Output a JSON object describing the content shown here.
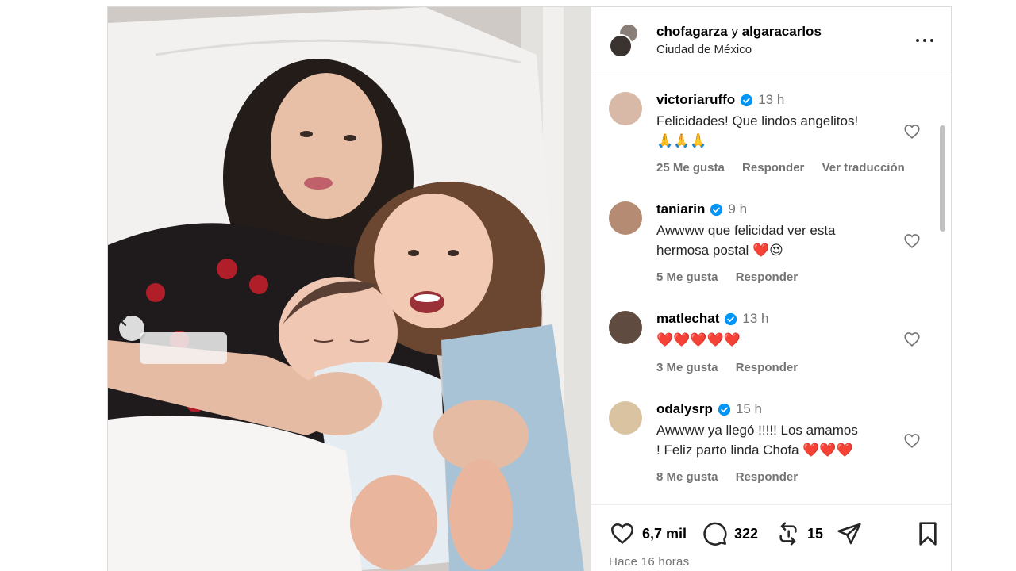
{
  "header": {
    "user1": "chofagarza",
    "conjunction": "y",
    "user2": "algaracarlos",
    "location": "Ciudad de México"
  },
  "comments": [
    {
      "username": "victoriaruffo",
      "time": "13 h",
      "text_line1": "Felicidades! Que lindos angelitos!",
      "text_line2": "🙏🙏🙏",
      "likes": "25 Me gusta",
      "reply": "Responder",
      "translate": "Ver traducción"
    },
    {
      "username": "taniarin",
      "time": "9 h",
      "text_line1": "Awwww que felicidad ver esta",
      "text_line2": "hermosa postal ❤️😍",
      "likes": "5 Me gusta",
      "reply": "Responder"
    },
    {
      "username": "matlechat",
      "time": "13 h",
      "text_line1": "❤️❤️❤️❤️❤️",
      "likes": "3 Me gusta",
      "reply": "Responder"
    },
    {
      "username": "odalysrp",
      "time": "15 h",
      "text_line1": "Awwww ya llegó !!!!! Los amamos",
      "text_line2": "! Feliz parto linda Chofa ❤️❤️❤️",
      "likes": "8 Me gusta",
      "reply": "Responder"
    }
  ],
  "actions": {
    "likes_count": "6,7 mil",
    "comments_count": "322",
    "reposts_count": "15"
  },
  "posted": "Hace 16 horas",
  "colors": {
    "verified": "#0095f6",
    "secondary_text": "#737373"
  }
}
